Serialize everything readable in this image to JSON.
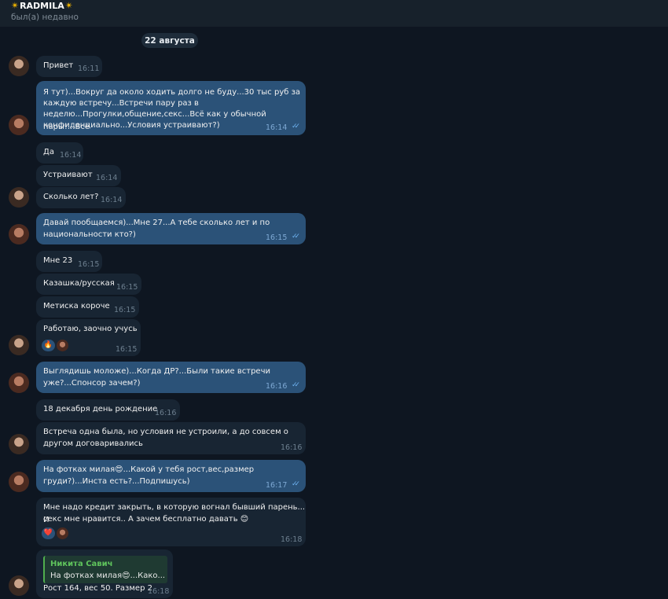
{
  "header": {
    "title": "RADMILA",
    "title_decor": "✴",
    "status": "был(а) недавно"
  },
  "chat": {
    "date": "22 августа",
    "messages": [
      {
        "text": "Привет",
        "time": "16:11"
      },
      {
        "text_lines": [
          "Я тут)...Вокруг да около ходить долго не буду...30 тыс руб за",
          "каждую встречу...Встречи пару раз в",
          "неделю...Прогулки,общение,секс...Всё как у обычной пары!...Всё",
          "конфиденциально...Условия устраивают?)"
        ],
        "time": "16:14"
      },
      {
        "text": "Да",
        "time": "16:14"
      },
      {
        "text": "Устраивают",
        "time": "16:14"
      },
      {
        "text": "Сколько лет?",
        "time": "16:14"
      },
      {
        "text_lines": [
          "Давай пообщаемся)...Мне 27...А тебе сколько лет и по",
          "национальности кто?)"
        ],
        "time": "16:15"
      },
      {
        "text": "Мне 23",
        "time": "16:15"
      },
      {
        "text": "Казашка/русская",
        "time": "16:15"
      },
      {
        "text": "Метиска короче",
        "time": "16:15"
      },
      {
        "text": "Работаю, заочно учусь",
        "time": "16:15",
        "reaction": "🔥"
      },
      {
        "text_lines": [
          "Выглядишь моложе)...Когда ДР?...Были такие встречи",
          "уже?...Спонсор зачем?)"
        ],
        "time": "16:16"
      },
      {
        "text": "18 декабря день рождение",
        "time": "16:16"
      },
      {
        "text_lines": [
          "Встреча одна была, но условия не устроили, а до совсем о",
          "другом договаривались"
        ],
        "time": "16:16"
      },
      {
        "text_lines": [
          "На фотках милая😍...Какой у тебя рост,вес,размер",
          "груди?)...Инста есть?...Подпишусь)"
        ],
        "time": "16:17"
      },
      {
        "text_lines": [
          "Мне надо кредит закрыть, в которую вогнал бывший парень... И",
          "секс мне нравится.. А зачем бесплатно давать 😊"
        ],
        "time": "16:18",
        "reaction": "❤️"
      },
      {
        "reply_name": "Никита Савич",
        "reply_text": "На фотках милая😍...Како...",
        "text": "Рост 164, вес 50. Размер 2",
        "time": "16:18"
      }
    ]
  },
  "colors": {
    "background": "#0e1621",
    "incoming": "#182533",
    "outgoing": "#2b5278",
    "reply_accent": "#4fae4e"
  },
  "icons": [
    "star-icon",
    "double-check-icon"
  ]
}
